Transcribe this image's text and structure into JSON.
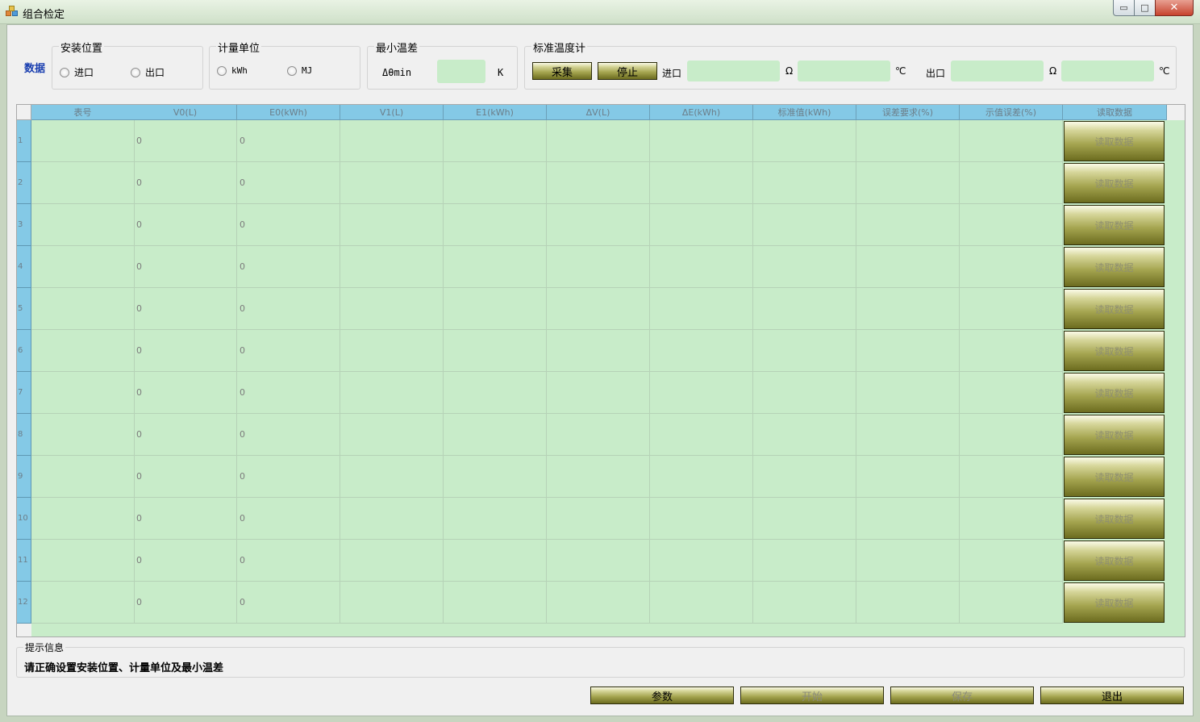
{
  "window": {
    "title": "组合检定",
    "minimize_glyph": "▭",
    "maximize_glyph": "□",
    "close_glyph": "✕",
    "icon": "app-icon"
  },
  "data_label": "数据",
  "install_position": {
    "title": "安装位置",
    "options": [
      "进口",
      "出口"
    ]
  },
  "metering_unit": {
    "title": "计量单位",
    "options": [
      "kWh",
      "MJ"
    ]
  },
  "min_temp_diff": {
    "title": "最小温差",
    "label": "Δθmin",
    "value": "",
    "unit": "K"
  },
  "std_thermometer": {
    "title": "标准温度计",
    "collect_button": "采集",
    "stop_button": "停止",
    "inlet_label": "进口",
    "outlet_label": "出口",
    "ohm_unit": "Ω",
    "celsius_unit": "℃",
    "inlet_ohm": "",
    "inlet_celsius": "",
    "outlet_ohm": "",
    "outlet_celsius": ""
  },
  "table": {
    "columns": [
      "表号",
      "V0(L)",
      "E0(kWh)",
      "V1(L)",
      "E1(kWh)",
      "ΔV(L)",
      "ΔE(kWh)",
      "标准值(kWh)",
      "误差要求(%)",
      "示值误差(%)",
      "读取数据"
    ],
    "rows": [
      {
        "index": "1",
        "meter_no": "",
        "v0": "0",
        "e0": "0",
        "v1": "",
        "e1": "",
        "dv": "",
        "de": "",
        "std": "",
        "req": "",
        "err": "",
        "action": "读取数据"
      },
      {
        "index": "2",
        "meter_no": "",
        "v0": "0",
        "e0": "0",
        "v1": "",
        "e1": "",
        "dv": "",
        "de": "",
        "std": "",
        "req": "",
        "err": "",
        "action": "读取数据"
      },
      {
        "index": "3",
        "meter_no": "",
        "v0": "0",
        "e0": "0",
        "v1": "",
        "e1": "",
        "dv": "",
        "de": "",
        "std": "",
        "req": "",
        "err": "",
        "action": "读取数据"
      },
      {
        "index": "4",
        "meter_no": "",
        "v0": "0",
        "e0": "0",
        "v1": "",
        "e1": "",
        "dv": "",
        "de": "",
        "std": "",
        "req": "",
        "err": "",
        "action": "读取数据"
      },
      {
        "index": "5",
        "meter_no": "",
        "v0": "0",
        "e0": "0",
        "v1": "",
        "e1": "",
        "dv": "",
        "de": "",
        "std": "",
        "req": "",
        "err": "",
        "action": "读取数据"
      },
      {
        "index": "6",
        "meter_no": "",
        "v0": "0",
        "e0": "0",
        "v1": "",
        "e1": "",
        "dv": "",
        "de": "",
        "std": "",
        "req": "",
        "err": "",
        "action": "读取数据"
      },
      {
        "index": "7",
        "meter_no": "",
        "v0": "0",
        "e0": "0",
        "v1": "",
        "e1": "",
        "dv": "",
        "de": "",
        "std": "",
        "req": "",
        "err": "",
        "action": "读取数据"
      },
      {
        "index": "8",
        "meter_no": "",
        "v0": "0",
        "e0": "0",
        "v1": "",
        "e1": "",
        "dv": "",
        "de": "",
        "std": "",
        "req": "",
        "err": "",
        "action": "读取数据"
      },
      {
        "index": "9",
        "meter_no": "",
        "v0": "0",
        "e0": "0",
        "v1": "",
        "e1": "",
        "dv": "",
        "de": "",
        "std": "",
        "req": "",
        "err": "",
        "action": "读取数据"
      },
      {
        "index": "10",
        "meter_no": "",
        "v0": "0",
        "e0": "0",
        "v1": "",
        "e1": "",
        "dv": "",
        "de": "",
        "std": "",
        "req": "",
        "err": "",
        "action": "读取数据"
      },
      {
        "index": "11",
        "meter_no": "",
        "v0": "0",
        "e0": "0",
        "v1": "",
        "e1": "",
        "dv": "",
        "de": "",
        "std": "",
        "req": "",
        "err": "",
        "action": "读取数据"
      },
      {
        "index": "12",
        "meter_no": "",
        "v0": "0",
        "e0": "0",
        "v1": "",
        "e1": "",
        "dv": "",
        "de": "",
        "std": "",
        "req": "",
        "err": "",
        "action": "读取数据"
      }
    ]
  },
  "hint": {
    "title": "提示信息",
    "message": "请正确设置安装位置、计量单位及最小温差"
  },
  "buttons": {
    "params": "参数",
    "start": "开始",
    "save": "保存",
    "exit": "退出"
  },
  "colors": {
    "field_green": "#c8ecc9",
    "header_blue": "#84c9e6",
    "button_olive": "#a4a44f",
    "data_label_blue": "#1a3fb0"
  }
}
